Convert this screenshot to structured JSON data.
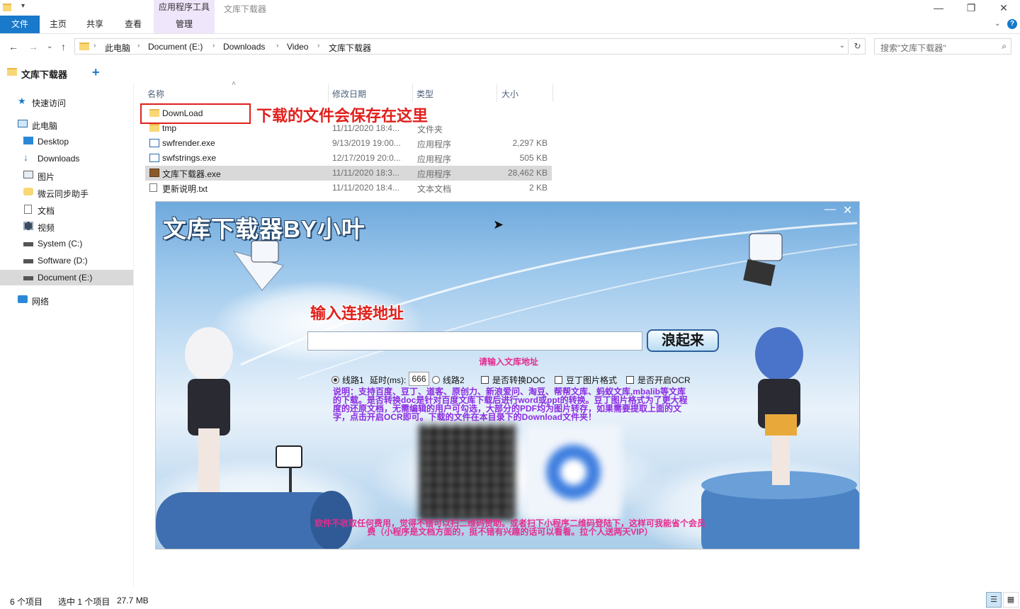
{
  "window": {
    "context_tab": "应用程序工具",
    "title": "文库下载器",
    "min": "—",
    "max": "❐",
    "close": "✕"
  },
  "ribbon": {
    "file": "文件",
    "home": "主页",
    "share": "共享",
    "view": "查看",
    "manage": "管理",
    "help": "?"
  },
  "address": {
    "crumbs": [
      "此电脑",
      "Document (E:)",
      "Downloads",
      "Video",
      "文库下载器"
    ],
    "search_placeholder": "搜索\"文库下载器\""
  },
  "tab": {
    "label": "文库下载器",
    "add": "+"
  },
  "nav": {
    "quick_access": "快速访问",
    "this_pc": "此电脑",
    "desktop": "Desktop",
    "downloads": "Downloads",
    "pictures": "图片",
    "weiyun": "微云同步助手",
    "documents": "文档",
    "videos": "视频",
    "system_c": "System (C:)",
    "software_d": "Software (D:)",
    "document_e": "Document (E:)",
    "network": "网络"
  },
  "columns": {
    "name": "名称",
    "date": "修改日期",
    "type": "类型",
    "size": "大小"
  },
  "files": [
    {
      "name": "DownLoad",
      "date": "",
      "type": "",
      "size": ""
    },
    {
      "name": "tmp",
      "date": "11/11/2020 18:4...",
      "type": "文件夹",
      "size": ""
    },
    {
      "name": "swfrender.exe",
      "date": "9/13/2019 19:00...",
      "type": "应用程序",
      "size": "2,297 KB"
    },
    {
      "name": "swfstrings.exe",
      "date": "12/17/2019 20:0...",
      "type": "应用程序",
      "size": "505 KB"
    },
    {
      "name": "文库下载器.exe",
      "date": "11/11/2020 18:3...",
      "type": "应用程序",
      "size": "28,462 KB"
    },
    {
      "name": "更新说明.txt",
      "date": "11/11/2020 18:4...",
      "type": "文本文档",
      "size": "2 KB"
    }
  ],
  "annotation": "下载的文件会保存在这里",
  "app": {
    "title": "文库下载器BY小叶",
    "min": "—",
    "close": "✕",
    "input_label": "输入连接地址",
    "url_value": "",
    "go_button": "浪起来",
    "hint": "请输入文库地址",
    "line1": "线路1",
    "delay_label": "延时(ms):",
    "delay_value": "666",
    "line2": "线路2",
    "convert_doc": "是否转换DOC",
    "doudin_image": "豆丁图片格式",
    "ocr": "是否开启OCR",
    "description": "说明：支持百度、豆丁、道客、原创力、新浪爱问、淘豆、帮帮文库、蚂蚁文库,mbalib等文库的下载。是否转换doc是针对百度文库下载后进行word或ppt的转换。豆丁图片格式为了更大程度的还原文档，无需编辑的用户可勾选，大部分的PDF均为图片转存，如果需要提取上面的文字，点击开启OCR即可。下载的文件在本目录下的Download文件夹！",
    "footer": "软件不收取任何费用，觉得不错可以扫二维码赞助。或者扫下小程序二维码登陆下，这样可我能省个会员费（小程序是文档方面的，挺不错有兴趣的话可以看看。拉个人送两天VIP）"
  },
  "status": {
    "count": "6 个项目",
    "selected": "选中 1 个项目",
    "size": "27.7 MB"
  }
}
